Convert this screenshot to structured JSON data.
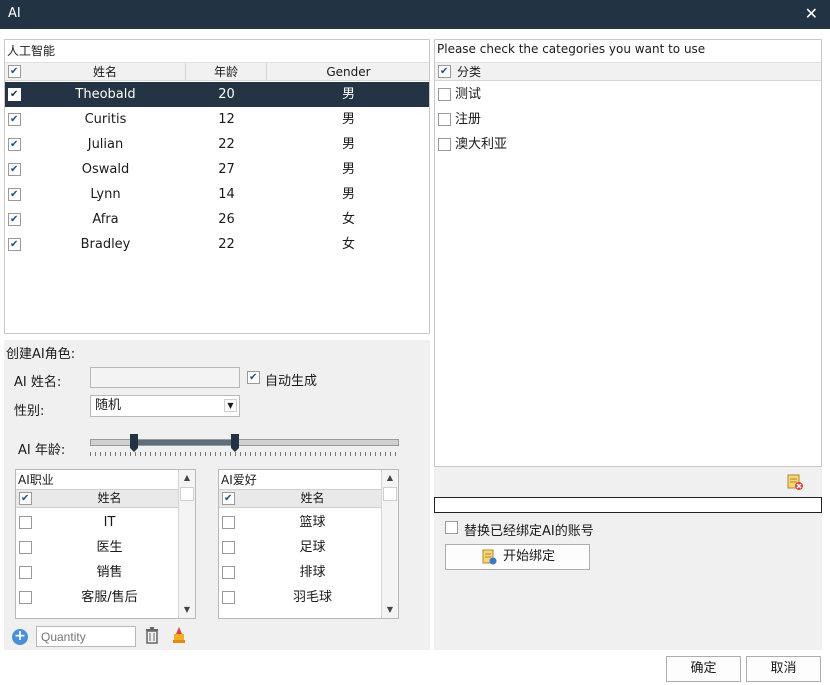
{
  "window": {
    "title": "AI"
  },
  "grid": {
    "caption": "人工智能",
    "headers": [
      "姓名",
      "年龄",
      "Gender"
    ],
    "rows": [
      {
        "name": "Theobald",
        "age": "20",
        "gender": "男",
        "checked": true,
        "selected": true
      },
      {
        "name": "Curitis",
        "age": "12",
        "gender": "男",
        "checked": true
      },
      {
        "name": "Julian",
        "age": "22",
        "gender": "男",
        "checked": true
      },
      {
        "name": "Oswald",
        "age": "27",
        "gender": "男",
        "checked": true
      },
      {
        "name": "Lynn",
        "age": "14",
        "gender": "男",
        "checked": true
      },
      {
        "name": "Afra",
        "age": "26",
        "gender": "女",
        "checked": true
      },
      {
        "name": "Bradley",
        "age": "22",
        "gender": "女",
        "checked": true
      }
    ]
  },
  "create": {
    "caption": "创建AI角色:",
    "name_label": "AI 姓名:",
    "name_value": "",
    "auto_label": "自动生成",
    "gender_label": "性别:",
    "gender_value": "随机",
    "age_label": "AI 年龄:",
    "age_range_fraction": [
      0.14,
      0.47
    ]
  },
  "occupation": {
    "caption": "AI职业",
    "header": "姓名",
    "items": [
      "IT",
      "医生",
      "销售",
      "客服/售后"
    ]
  },
  "hobby": {
    "caption": "AI爱好",
    "header": "姓名",
    "items": [
      "篮球",
      "足球",
      "排球",
      "羽毛球"
    ]
  },
  "quantity": {
    "placeholder": "Quantity",
    "value": ""
  },
  "categories": {
    "caption": "Please check the categories you want to use",
    "header": "分类",
    "items": [
      "测试",
      "注册",
      "澳大利亚"
    ]
  },
  "replace_label": "替换已经绑定AI的账号",
  "bind_button": "开始绑定",
  "ok_button": "确定",
  "cancel_button": "取消",
  "colors": {
    "titlebar": "#223344",
    "selected_row": "#243444"
  }
}
